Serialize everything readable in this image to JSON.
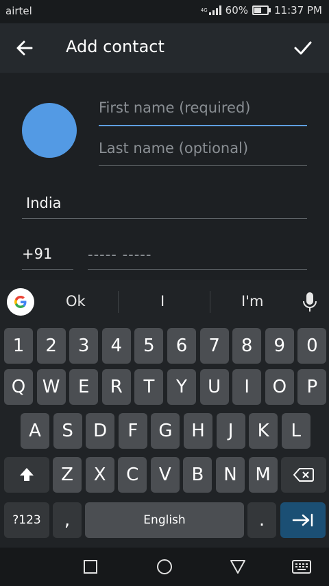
{
  "status_bar": {
    "carrier": "airtel",
    "network": "4G",
    "battery_percent": "60%",
    "battery_level": 0.6,
    "time": "11:37 PM"
  },
  "app_bar": {
    "title": "Add contact",
    "back_icon": "arrow-left-icon",
    "confirm_icon": "check-icon"
  },
  "form": {
    "avatar_color": "#539ae4",
    "first_name": {
      "value": "",
      "placeholder": "First name (required)"
    },
    "last_name": {
      "value": "",
      "placeholder": "Last name (optional)"
    },
    "country": "India",
    "country_code": "+91",
    "phone": {
      "value": "",
      "placeholder": "----- -----"
    }
  },
  "keyboard": {
    "suggestions": [
      "Ok",
      "I",
      "I'm"
    ],
    "number_row": [
      "1",
      "2",
      "3",
      "4",
      "5",
      "6",
      "7",
      "8",
      "9",
      "0"
    ],
    "row1": [
      "Q",
      "W",
      "E",
      "R",
      "T",
      "Y",
      "U",
      "I",
      "O",
      "P"
    ],
    "row2": [
      "A",
      "S",
      "D",
      "F",
      "G",
      "H",
      "J",
      "K",
      "L"
    ],
    "row3": [
      "Z",
      "X",
      "C",
      "V",
      "B",
      "N",
      "M"
    ],
    "symbols_label": "?123",
    "comma_label": ",",
    "space_label": "English",
    "period_label": ".",
    "accent_color": "#1b4f74"
  },
  "nav_bar": {
    "icons": [
      "recents-square-icon",
      "home-circle-icon",
      "back-triangle-icon",
      "keyboard-icon"
    ]
  }
}
